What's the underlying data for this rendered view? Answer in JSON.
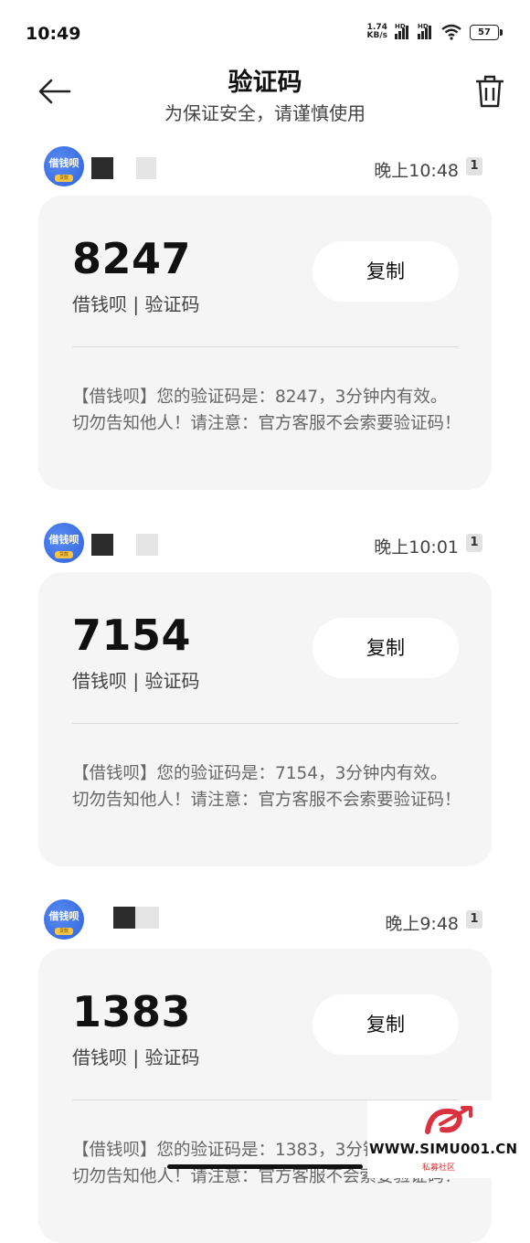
{
  "status_bar": {
    "time": "10:49",
    "net_speed_value": "1.74",
    "net_speed_unit": "KB/s",
    "hd_label": "HD",
    "battery": "57"
  },
  "header": {
    "title": "验证码",
    "subtitle": "为保证安全，请谨慎使用",
    "back_icon": "arrow-left-icon",
    "trash_icon": "trash-icon"
  },
  "messages": [
    {
      "avatar_text": "借钱呗",
      "avatar_sub": "贷款",
      "time": "晚上10:48",
      "count": "1",
      "code": "8247",
      "source": "借钱呗 | 验证码",
      "copy_label": "复制",
      "body": "【借钱呗】您的验证码是：8247，3分钟内有效。切勿告知他人！请注意：官方客服不会索要验证码！"
    },
    {
      "avatar_text": "借钱呗",
      "avatar_sub": "贷款",
      "time": "晚上10:01",
      "count": "1",
      "code": "7154",
      "source": "借钱呗 | 验证码",
      "copy_label": "复制",
      "body": "【借钱呗】您的验证码是：7154，3分钟内有效。切勿告知他人！请注意：官方客服不会索要验证码！"
    },
    {
      "avatar_text": "借钱呗",
      "avatar_sub": "贷款",
      "time": "晚上9:48",
      "count": "1",
      "code": "1383",
      "source": "借钱呗 | 验证码",
      "copy_label": "复制",
      "body": "【借钱呗】您的验证码是：1383，3分钟内有效。切勿告知他人！请注意：官方客服不会索要验证码！"
    }
  ],
  "watermark": {
    "site": "WWW.SIMU001.CN",
    "label": "私募社区"
  },
  "colors": {
    "card_bg": "#f4f5f4",
    "avatar_blue": "#2e61d8",
    "watermark_red": "#d9333f"
  }
}
